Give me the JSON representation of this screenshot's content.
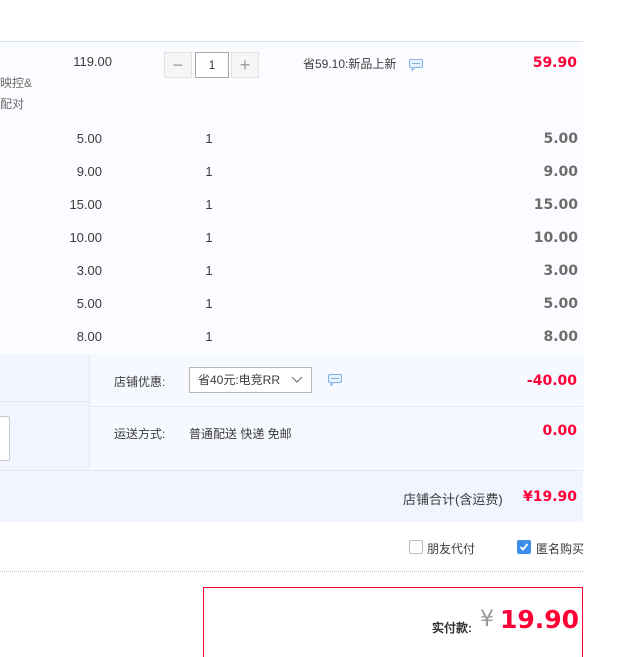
{
  "item": {
    "title_lines": [
      "映控&",
      "配对"
    ],
    "unit_price": "119.00",
    "quantity": "1",
    "minus_label": "−",
    "plus_label": "+",
    "promo_text": "省59.10:新品上新",
    "total": "59.90"
  },
  "sub_items": [
    {
      "price": "5.00",
      "qty": "1",
      "total": "5.00"
    },
    {
      "price": "9.00",
      "qty": "1",
      "total": "9.00"
    },
    {
      "price": "15.00",
      "qty": "1",
      "total": "15.00"
    },
    {
      "price": "10.00",
      "qty": "1",
      "total": "10.00"
    },
    {
      "price": "3.00",
      "qty": "1",
      "total": "3.00"
    },
    {
      "price": "5.00",
      "qty": "1",
      "total": "5.00"
    },
    {
      "price": "8.00",
      "qty": "1",
      "total": "8.00"
    }
  ],
  "shop": {
    "discount_label": "店铺优惠:",
    "discount_select": "省40元:电竞RR",
    "discount_value": "-40.00",
    "shipping_label": "运送方式:",
    "shipping_value_text": "普通配送 快递 免邮",
    "shipping_cost": "0.00",
    "subtotal_label": "店铺合计(含运费)",
    "subtotal_value": "¥19.90"
  },
  "options": {
    "friend_pay_label": "朋友代付",
    "friend_pay_checked": false,
    "anonymous_label": "匿名购买",
    "anonymous_checked": true
  },
  "payment": {
    "label": "实付款:",
    "currency": "¥",
    "amount": "19.90"
  },
  "colors": {
    "accent": "#ff0036",
    "checkbox_on": "#3d8eea"
  }
}
